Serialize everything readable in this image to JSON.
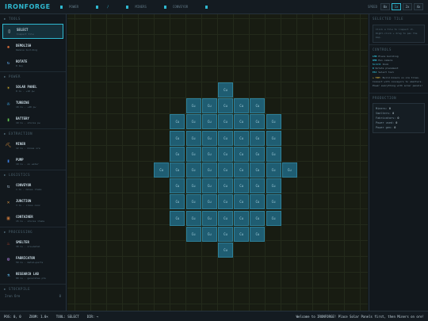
{
  "app": {
    "title": "IRONFORGE"
  },
  "stats": [
    {
      "label": "POWER",
      "value": "",
      "icon": "power-icon"
    },
    {
      "label": "",
      "value": "/",
      "icon": "bar-icon"
    },
    {
      "label": "MINERS",
      "value": "",
      "icon": "miner-icon"
    },
    {
      "label": "CONVEYOR",
      "value": "",
      "icon": "conveyor-icon"
    },
    {
      "label": "",
      "value": "",
      "icon": "bar-icon"
    }
  ],
  "speed": {
    "label": "SPEED",
    "options": [
      "0x",
      "1x",
      "2x",
      "4x"
    ],
    "active": 1
  },
  "sidebar": {
    "sections": [
      {
        "title": "▶ TOOLS",
        "tools": [
          {
            "name": "SELECT",
            "desc": "Inspect tile",
            "icon": "▯",
            "color": "#e0e6ea",
            "active": true
          },
          {
            "name": "DEMOLISH",
            "desc": "Remove building",
            "icon": "✸",
            "color": "#e0703a"
          },
          {
            "name": "ROTATE",
            "desc": "R key",
            "icon": "↻",
            "color": "#5aa0e0"
          }
        ]
      },
      {
        "title": "▶ POWER",
        "tools": [
          {
            "name": "SOLAR PANEL",
            "desc": "8 Cu · +10 pw",
            "icon": "☀",
            "color": "#e8c030"
          },
          {
            "name": "TURBINE",
            "desc": "18 Cu · +40 pw",
            "icon": "✇",
            "color": "#3aa0e0"
          },
          {
            "name": "BATTERY",
            "desc": "10 Cu · stores pw",
            "icon": "▮",
            "color": "#60c050"
          }
        ]
      },
      {
        "title": "▶ EXTRACTION",
        "tools": [
          {
            "name": "MINER",
            "desc": "12 Cu · mines ore",
            "icon": "⛏",
            "color": "#d08a3a"
          },
          {
            "name": "PUMP",
            "desc": "10 Cu · on water",
            "icon": "▮",
            "color": "#3a7ad8"
          }
        ]
      },
      {
        "title": "▶ LOGISTICS",
        "tools": [
          {
            "name": "CONVEYOR",
            "desc": "1 Cu · moves items",
            "icon": "⇆",
            "color": "#8aa0b0"
          },
          {
            "name": "JUNCTION",
            "desc": "3 Cu · cross conv",
            "icon": "✕",
            "color": "#d09040"
          },
          {
            "name": "CONTAINER",
            "desc": "15 Cu · stores items",
            "icon": "▣",
            "color": "#d07a3a"
          }
        ]
      },
      {
        "title": "▶ PROCESSING",
        "tools": [
          {
            "name": "SMELTER",
            "desc": "30 Cu · ore→metal",
            "icon": "♨",
            "color": "#e05030"
          },
          {
            "name": "FABRICATOR",
            "desc": "50 Cu · metal→parts",
            "icon": "⚙",
            "color": "#b080e0"
          },
          {
            "name": "RESEARCH LAB",
            "desc": "80 Cu · generates pts",
            "icon": "⚗",
            "color": "#5ab0e0"
          }
        ]
      }
    ],
    "stockpile": {
      "title": "▶ STOCKPILE",
      "rows": [
        {
          "label": "Iron Ore",
          "value": "0"
        }
      ]
    }
  },
  "rpanel": {
    "selected_title": "SELECTED TILE",
    "selected_hint": "Click a tile to inspect it. Right-click + drag to pan the map.",
    "controls_title": "CONTROLS",
    "controls": [
      {
        "key": "LMB",
        "text": "Place building"
      },
      {
        "key": "RMB",
        "text": "Pan camera"
      },
      {
        "key": "Scroll",
        "text": "Zoom"
      },
      {
        "key": "R",
        "text": "Rotate placement"
      },
      {
        "key": "ESC",
        "text": "Select tool"
      }
    ],
    "tip_label": "TIP:",
    "tip_text": "Build miners on ore tiles. Connect with conveyors to smelters. Power everything with solar panels!",
    "production_title": "PRODUCTION",
    "production": [
      {
        "label": "Miners:",
        "value": "0"
      },
      {
        "label": "Smelters:",
        "value": "0"
      },
      {
        "label": "Fabricators:",
        "value": "0"
      },
      {
        "label": "Power used:",
        "value": "0"
      },
      {
        "label": "Power gen:",
        "value": "0"
      }
    ]
  },
  "grid": {
    "ore_label": "Cu",
    "ore_color": "#1f5d72",
    "rows": [
      {
        "row": 0,
        "start": 5,
        "end": 5
      },
      {
        "row": 1,
        "start": 3,
        "end": 7
      },
      {
        "row": 2,
        "start": 2,
        "end": 8
      },
      {
        "row": 3,
        "start": 2,
        "end": 8
      },
      {
        "row": 4,
        "start": 2,
        "end": 8
      },
      {
        "row": 5,
        "start": 1,
        "end": 9
      },
      {
        "row": 6,
        "start": 2,
        "end": 8
      },
      {
        "row": 7,
        "start": 2,
        "end": 8
      },
      {
        "row": 8,
        "start": 2,
        "end": 8
      },
      {
        "row": 9,
        "start": 3,
        "end": 7
      },
      {
        "row": 10,
        "start": 5,
        "end": 5
      }
    ]
  },
  "bottombar": {
    "pos": "POS: 0, 0",
    "zoom": "ZOOM: 1.0×",
    "tool": "TOOL: SELECT",
    "dir": "DIR: →",
    "message": "Welcome to IRONFORGE! Place Solar Panels first, then Miners on ore!"
  }
}
